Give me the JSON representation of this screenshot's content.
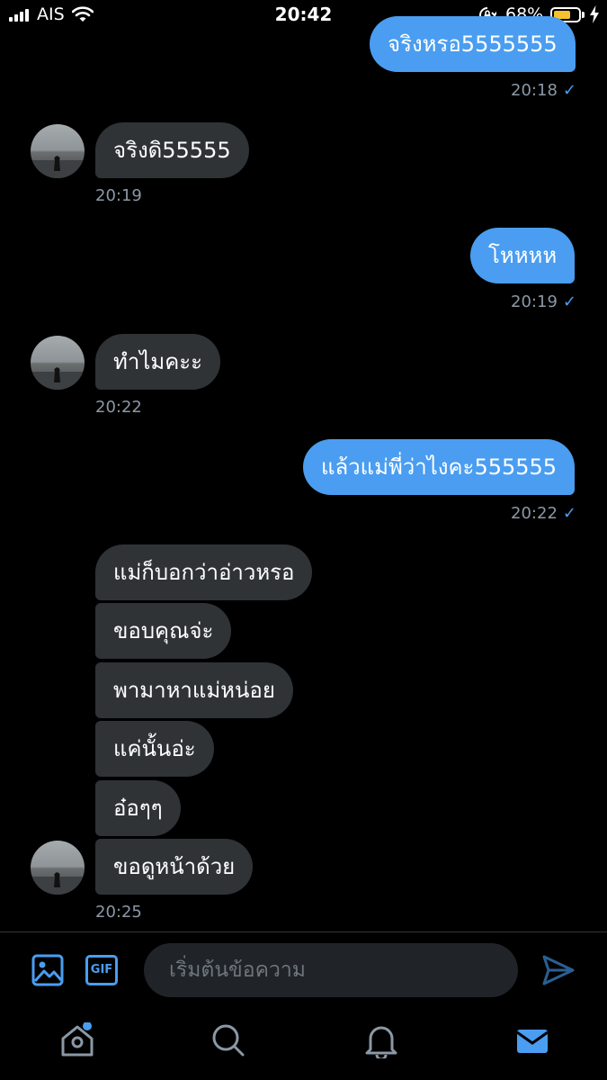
{
  "status_bar": {
    "carrier": "AIS",
    "time": "20:42",
    "battery_percent": "68%",
    "battery_level": 0.68,
    "battery_color": "#f5c22b"
  },
  "messages": [
    {
      "dir": "out",
      "text": "จริงหรอ5555555",
      "time": "20:18",
      "check": "✓"
    },
    {
      "dir": "in",
      "text": "จริงดิ55555",
      "time": "20:19"
    },
    {
      "dir": "out",
      "text": "โหหหห",
      "time": "20:19",
      "check": "✓"
    },
    {
      "dir": "in",
      "text": "ทำไมคะะ",
      "time": "20:22"
    },
    {
      "dir": "out",
      "text": "แล้วแม่พี่ว่าไงคะ555555",
      "time": "20:22",
      "check": "✓"
    },
    {
      "dir": "in",
      "text": "แม่ก็บอกว่าอ่าวหรอ"
    },
    {
      "dir": "in",
      "text": "ขอบคุณจ่ะ"
    },
    {
      "dir": "in",
      "text": "พามาหาแม่หน่อย"
    },
    {
      "dir": "in",
      "text": "แค่นั้นอ่ะ"
    },
    {
      "dir": "in",
      "text": "อ๋อๆๆ"
    },
    {
      "dir": "in",
      "text": "ขอดูหน้าด้วย",
      "time": "20:25"
    }
  ],
  "composer": {
    "placeholder": "เริ่มต้นข้อความ",
    "gif_label": "GIF"
  },
  "colors": {
    "accent": "#4a9df0",
    "incoming_bubble": "#2f3336",
    "timestamp": "#8b98a5"
  },
  "tabs": [
    "home-icon",
    "search-icon",
    "bell-icon",
    "mail-icon"
  ]
}
